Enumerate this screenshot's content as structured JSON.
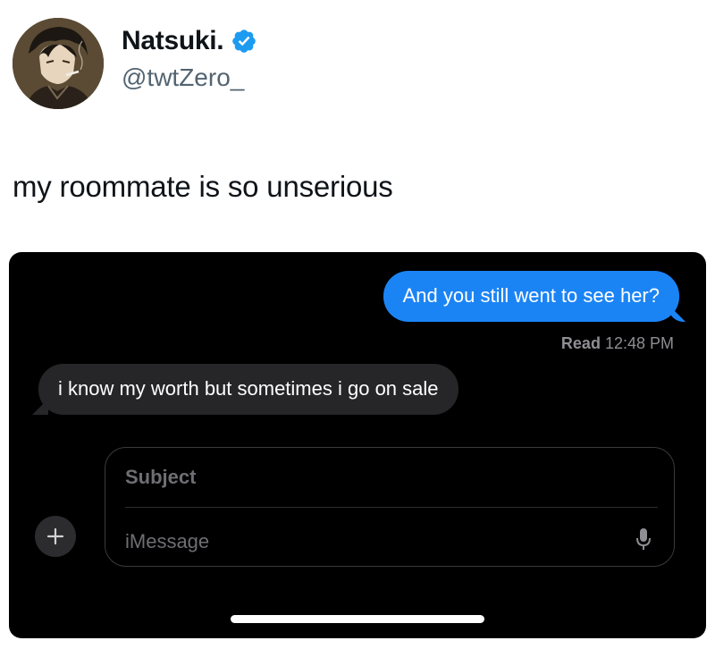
{
  "tweet": {
    "display_name": "Natsuki.",
    "handle": "@twtZero_",
    "verified_icon": "verified-badge-icon",
    "text": "my roommate is so unserious",
    "avatar": "avatar-illustration"
  },
  "imessage": {
    "outgoing_message": "And you still went to see her?",
    "read_label": "Read",
    "read_time": "12:48 PM",
    "incoming_message": "i know my worth but sometimes i go on sale",
    "subject_placeholder": "Subject",
    "message_placeholder": "iMessage",
    "plus_icon": "plus-icon",
    "mic_icon": "microphone-icon"
  },
  "colors": {
    "outgoing_bubble": "#1b84f5",
    "incoming_bubble": "#262628",
    "verified": "#1d9bf0",
    "screen_bg": "#000000",
    "handle": "#536471"
  }
}
